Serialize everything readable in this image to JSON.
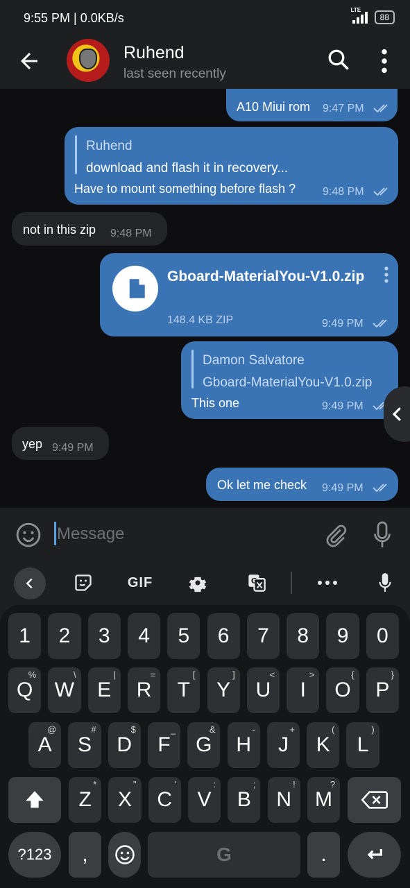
{
  "status_bar": {
    "time": "9:55 PM | 0.0KB/s",
    "network": "LTE",
    "battery": "88"
  },
  "header": {
    "name": "Ruhend",
    "status": "last seen recently"
  },
  "messages": {
    "m1": {
      "text": "A10 Miui rom",
      "time": "9:47 PM"
    },
    "m2": {
      "reply_name": "Ruhend",
      "reply_text": "download and flash it in recovery...",
      "text": "Have to mount something before flash ?",
      "time": "9:48 PM"
    },
    "m3": {
      "text": "not in this zip",
      "time": "9:48 PM"
    },
    "m4": {
      "file_name": "Gboard-MaterialYou-V1.0.zip",
      "file_size": "148.4 KB ZIP",
      "time": "9:49 PM"
    },
    "m5": {
      "reply_name": "Damon Salvatore",
      "reply_text": "Gboard-MaterialYou-V1.0.zip",
      "text": "This one",
      "time": "9:49 PM"
    },
    "m6": {
      "text": "yep",
      "time": "9:49 PM"
    },
    "m7": {
      "text": "Ok let me check",
      "time": "9:49 PM"
    }
  },
  "composer": {
    "placeholder": "Message"
  },
  "keyboard": {
    "toolbar": {
      "gif": "GIF"
    },
    "row_numbers": [
      "1",
      "2",
      "3",
      "4",
      "5",
      "6",
      "7",
      "8",
      "9",
      "0"
    ],
    "row_q": [
      {
        "k": "Q",
        "s": "%"
      },
      {
        "k": "W",
        "s": "\\"
      },
      {
        "k": "E",
        "s": "|"
      },
      {
        "k": "R",
        "s": "="
      },
      {
        "k": "T",
        "s": "["
      },
      {
        "k": "Y",
        "s": "]"
      },
      {
        "k": "U",
        "s": "<"
      },
      {
        "k": "I",
        "s": ">"
      },
      {
        "k": "O",
        "s": "{"
      },
      {
        "k": "P",
        "s": "}"
      }
    ],
    "row_a": [
      {
        "k": "A",
        "s": "@"
      },
      {
        "k": "S",
        "s": "#"
      },
      {
        "k": "D",
        "s": "$"
      },
      {
        "k": "F",
        "s": "_"
      },
      {
        "k": "G",
        "s": "&"
      },
      {
        "k": "H",
        "s": "-"
      },
      {
        "k": "J",
        "s": "+"
      },
      {
        "k": "K",
        "s": "("
      },
      {
        "k": "L",
        "s": ")"
      }
    ],
    "row_z": [
      {
        "k": "Z",
        "s": "*"
      },
      {
        "k": "X",
        "s": "\""
      },
      {
        "k": "C",
        "s": "'"
      },
      {
        "k": "V",
        "s": ":"
      },
      {
        "k": "B",
        "s": ";"
      },
      {
        "k": "N",
        "s": "!"
      },
      {
        "k": "M",
        "s": "?"
      }
    ],
    "symbols_key": "?123",
    "comma_key": ",",
    "period_key": ".",
    "space_logo": "G"
  },
  "icons": {
    "back": "arrow-left-icon",
    "search": "search-icon",
    "menu": "more-vert-icon",
    "ticks": "double-check-icon",
    "file": "file-icon",
    "emoji": "emoji-icon",
    "attach": "paperclip-icon",
    "mic": "mic-icon"
  },
  "colors": {
    "outgoing": "#3b74b5",
    "incoming": "#242527",
    "accent": "#5aa1e3",
    "header": "#1e1f21"
  }
}
